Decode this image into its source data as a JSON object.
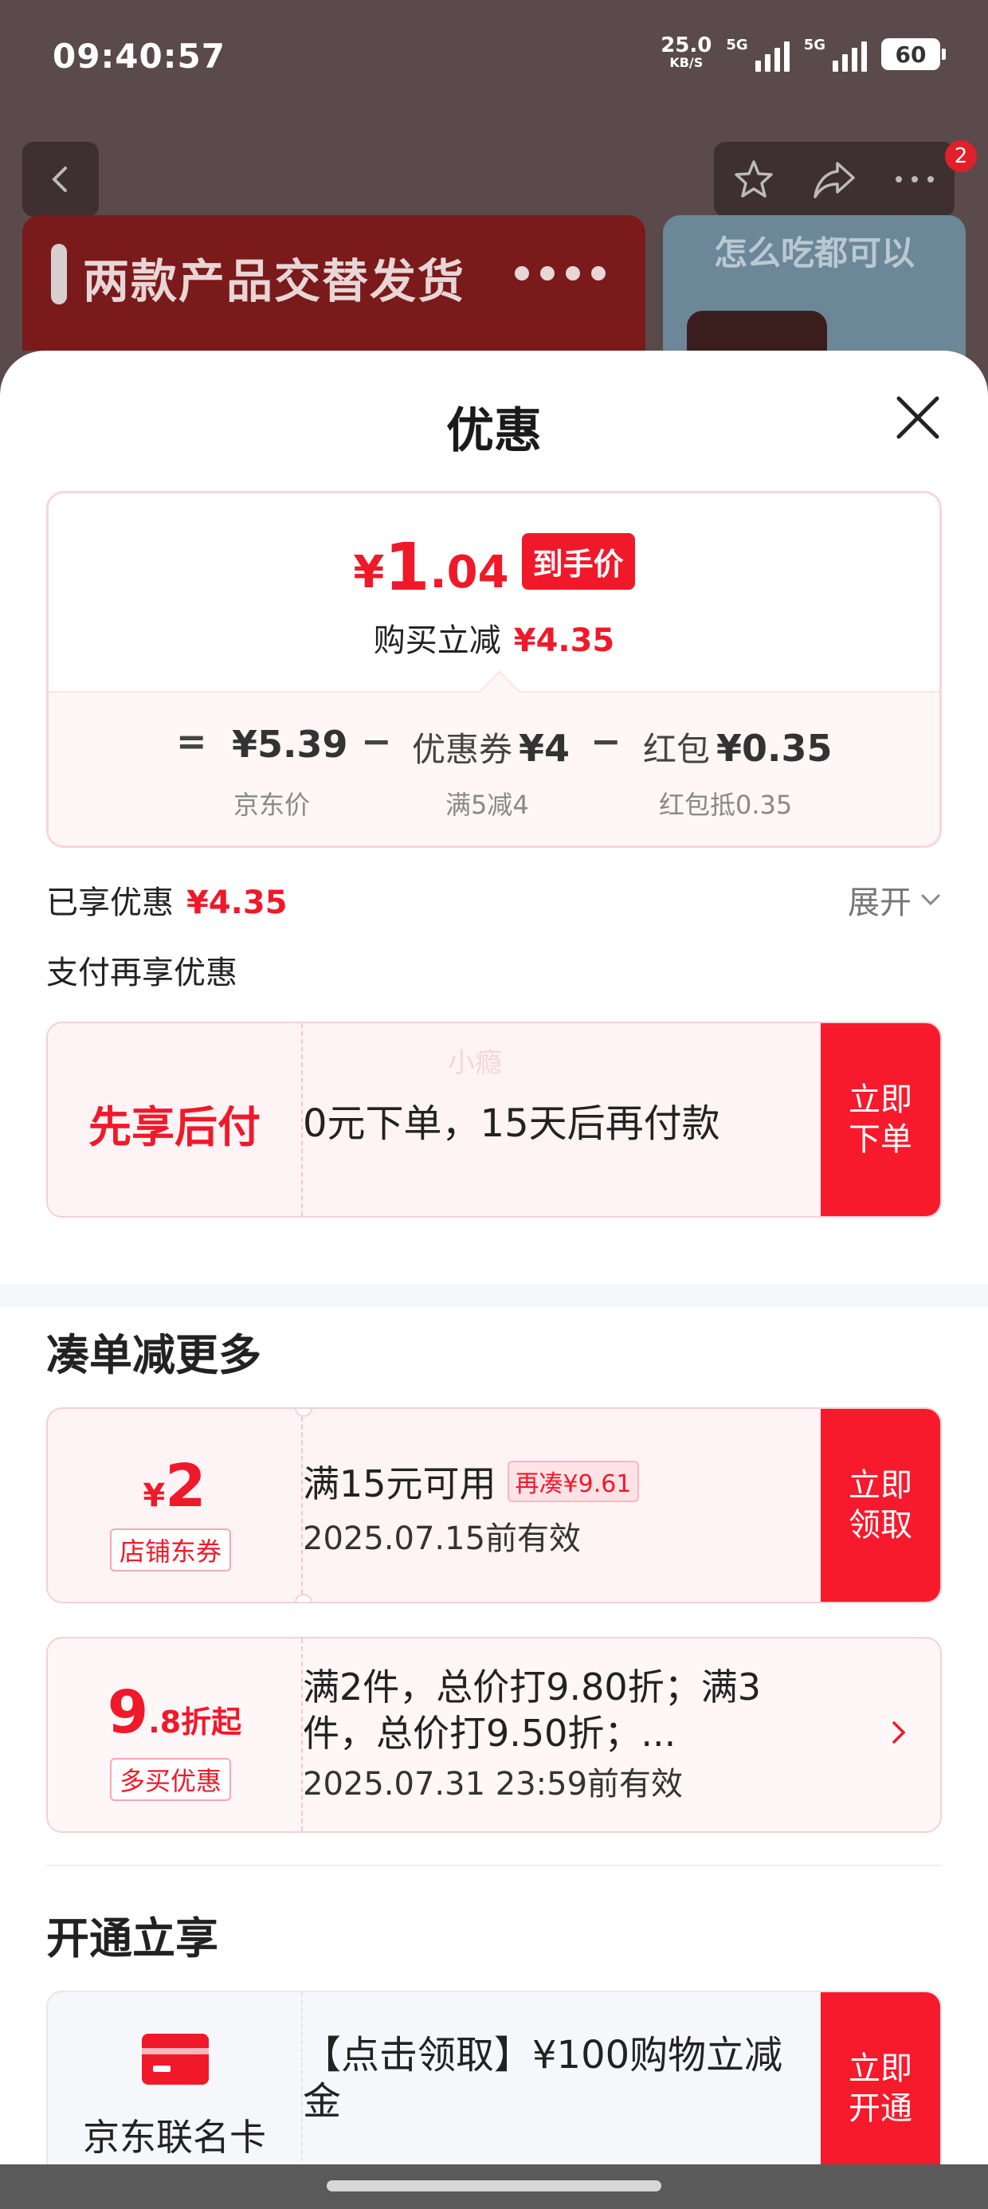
{
  "status_bar": {
    "time": "09:40:57",
    "net_speed": "25.0",
    "net_unit": "KB/S",
    "sig1_label": "5G",
    "sig2_label": "5G",
    "battery": "60"
  },
  "background": {
    "banner_text": "两款产品交替发货",
    "right_banner_text": "怎么吃都可以",
    "notification_count": "2"
  },
  "sheet": {
    "title": "优惠"
  },
  "price_card": {
    "yen": "¥",
    "price_int": "1",
    "price_dec": ".04",
    "price_tag": "到手价",
    "reduce_label": "购买立减",
    "reduce_value": "¥4.35",
    "equals": "=",
    "jd_price": "¥5.39",
    "jd_price_label": "京东价",
    "minus1": "−",
    "coupon_label": "优惠券",
    "coupon_value": "¥4",
    "coupon_sub": "满5减4",
    "minus2": "−",
    "redpack_label": "红包",
    "redpack_value": "¥0.35",
    "redpack_sub": "红包抵0.35"
  },
  "enjoyed": {
    "label": "已享优惠",
    "value": "¥4.35",
    "expand_label": "展开"
  },
  "pay_section": {
    "title": "支付再享优惠",
    "bnpl_title": "先享后付",
    "bnpl_watermark": "小瘾",
    "bnpl_desc": "0元下单，15天后再付款",
    "bnpl_action": "立即下单"
  },
  "more_section": {
    "title": "凑单减更多",
    "coupon": {
      "yen": "¥",
      "amount": "2",
      "tag": "店铺东券",
      "condition": "满15元可用",
      "pill": "再凑¥9.61",
      "expiry": "2025.07.15前有效",
      "action": "立即领取"
    },
    "discount": {
      "big": "9",
      "small": ".8折起",
      "tag": "多买优惠",
      "desc": "满2件，总价打9.80折；满3件，总价打9.50折；...",
      "expiry": "2025.07.31 23:59前有效"
    }
  },
  "open_section": {
    "title": "开通立享",
    "card": {
      "name": "京东联名卡",
      "desc": "【点击领取】¥100购物立减金",
      "action": "立即开通"
    }
  },
  "colors": {
    "accent_red": "#f0192a",
    "coupon_bg": "#fff4f5",
    "button_red": "#f61a2c"
  },
  "icons": [
    "back-icon",
    "star-icon",
    "share-icon",
    "more-icon",
    "close-icon",
    "chevron-down-icon",
    "chevron-right-icon",
    "credit-card-icon"
  ]
}
